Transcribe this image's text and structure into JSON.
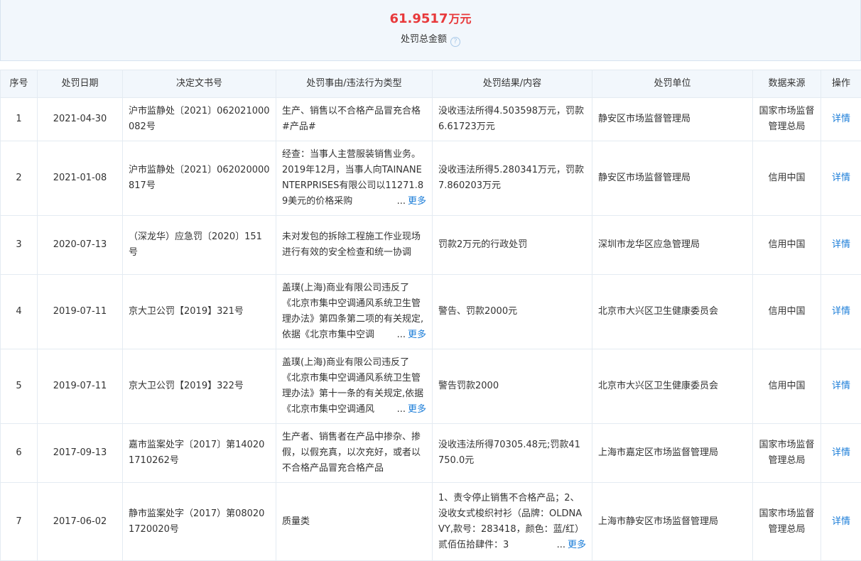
{
  "summary": {
    "amount": "61.9517",
    "unit": "万元",
    "label": "处罚总金额",
    "help_glyph": "?"
  },
  "table": {
    "headers": [
      "序号",
      "处罚日期",
      "决定文书号",
      "处罚事由/违法行为类型",
      "处罚结果/内容",
      "处罚单位",
      "数据来源",
      "操作"
    ],
    "more_label": "更多",
    "ellipsis": "...",
    "rows": [
      {
        "index": "1",
        "date": "2021-04-30",
        "doc_no": "沪市监静处〔2021〕062021000082号",
        "reason": "生产、销售以不合格产品冒充合格#产品#",
        "reason_more": false,
        "result": "没收违法所得4.503598万元，罚款6.61723万元",
        "result_more": false,
        "agency": "静安区市场监督管理局",
        "source": "国家市场监督管理总局",
        "action": "详情"
      },
      {
        "index": "2",
        "date": "2021-01-08",
        "doc_no": "沪市监静处〔2021〕062020000817号",
        "reason": "经查：当事人主营服装销售业务。2019年12月，当事人向TAINANENTERPRISES有限公司以11271.89美元的价格采购",
        "reason_more": true,
        "result": "没收违法所得5.280341万元，罚款7.860203万元",
        "result_more": false,
        "agency": "静安区市场监督管理局",
        "source": "信用中国",
        "action": "详情"
      },
      {
        "index": "3",
        "date": "2020-07-13",
        "doc_no": "（深龙华）应急罚〔2020〕151号",
        "reason": "未对发包的拆除工程施工作业现场进行有效的安全检查和统一协调",
        "reason_more": false,
        "result": "罚款2万元的行政处罚",
        "result_more": false,
        "agency": "深圳市龙华区应急管理局",
        "source": "信用中国",
        "action": "详情"
      },
      {
        "index": "4",
        "date": "2019-07-11",
        "doc_no": "京大卫公罚【2019】321号",
        "reason": "盖璞(上海)商业有限公司违反了《北京市集中空调通风系统卫生管理办法》第四条第二项的有关规定,依据《北京市集中空调",
        "reason_more": true,
        "result": "警告、罚款2000元",
        "result_more": false,
        "agency": "北京市大兴区卫生健康委员会",
        "source": "信用中国",
        "action": "详情"
      },
      {
        "index": "5",
        "date": "2019-07-11",
        "doc_no": "京大卫公罚【2019】322号",
        "reason": "盖璞(上海)商业有限公司违反了《北京市集中空调通风系统卫生管理办法》第十一条的有关规定,依据《北京市集中空调通风",
        "reason_more": true,
        "result": "警告罚款2000",
        "result_more": false,
        "agency": "北京市大兴区卫生健康委员会",
        "source": "信用中国",
        "action": "详情"
      },
      {
        "index": "6",
        "date": "2017-09-13",
        "doc_no": "嘉市监案处字〔2017〕第140201710262号",
        "reason": "生产者、销售者在产品中掺杂、掺假，以假充真，以次充好，或者以不合格产品冒充合格产品",
        "reason_more": false,
        "result": "没收违法所得70305.48元;罚款41750.0元",
        "result_more": false,
        "agency": "上海市嘉定区市场监督管理局",
        "source": "国家市场监督管理总局",
        "action": "详情"
      },
      {
        "index": "7",
        "date": "2017-06-02",
        "doc_no": "静市监案处字（2017）第080201720020号",
        "reason": "质量类",
        "reason_more": false,
        "result": "1、责令停止销售不合格产品；2、没收女式梭织衬衫（品牌：OLDNAVY,款号：283418，颜色：蓝/红）贰佰伍拾肆件：3",
        "result_more": true,
        "agency": "上海市静安区市场监督管理局",
        "source": "国家市场监督管理总局",
        "action": "详情"
      }
    ]
  },
  "colors": {
    "accent_red": "#e8393b",
    "link_blue": "#1b7dd8",
    "header_bg": "#f2f7fc",
    "border": "#e4ebf2"
  }
}
